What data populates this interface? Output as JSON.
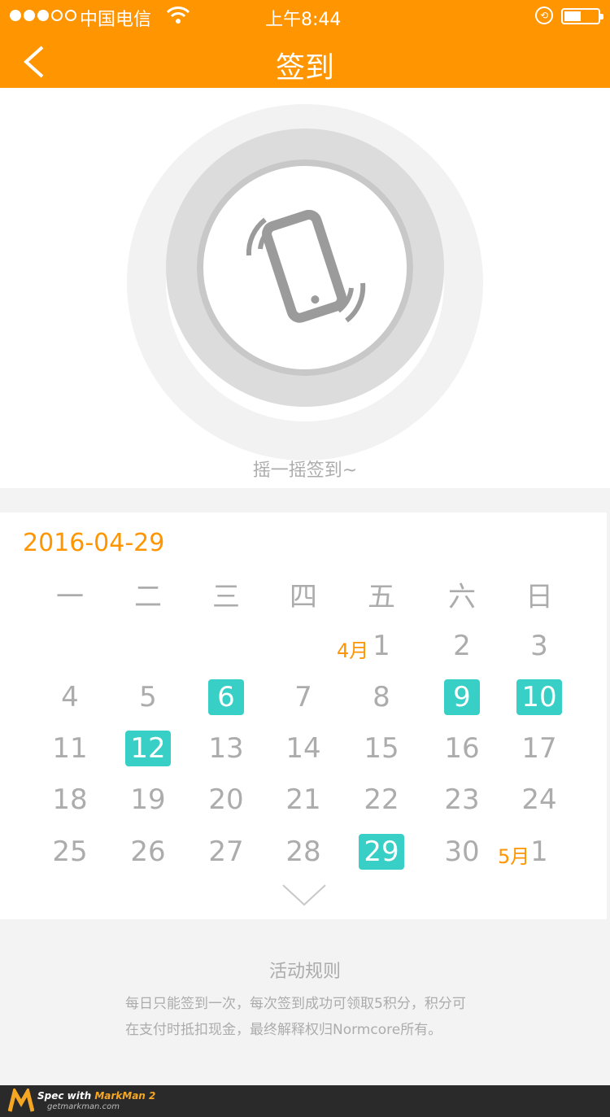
{
  "status_bar": {
    "carrier": "中国电信",
    "time": "上午8:44"
  },
  "nav": {
    "title": "签到",
    "back_icon": "chevron-left-icon"
  },
  "hero": {
    "shake_text": "摇一摇签到~",
    "icon": "phone-shake-icon"
  },
  "calendar": {
    "date": "2016-04-29",
    "weekdays": [
      "一",
      "二",
      "三",
      "四",
      "五",
      "六",
      "日"
    ],
    "weeks": [
      [
        "",
        "",
        "",
        "1",
        "2",
        "3",
        ""
      ],
      [
        "4",
        "5",
        "6",
        "7",
        "8",
        "9",
        "10"
      ],
      [
        "11",
        "12",
        "13",
        "14",
        "15",
        "16",
        "17"
      ],
      [
        "18",
        "19",
        "20",
        "21",
        "22",
        "23",
        "24"
      ],
      [
        "25",
        "26",
        "27",
        "28",
        "29",
        "30",
        "1"
      ]
    ],
    "month_markers": {
      "april": "4月",
      "may": "5月"
    },
    "signed_days": [
      "6",
      "9",
      "10",
      "12",
      "29"
    ],
    "signed_color": "#38cfc6",
    "text_color": "#acacac",
    "accent_color": "#ff9500",
    "expand_icon": "chevron-down-icon"
  },
  "rules": {
    "title": "活动规则",
    "line1": "每日只能签到一次，每次签到成功可领取5积分，积分可",
    "line2": "在支付时抵扣现金，最终解释权归Normcore所有。"
  },
  "markman": {
    "spec_with": "Spec with ",
    "brand": "MarkMan 2",
    "url": "getmarkman.com"
  }
}
